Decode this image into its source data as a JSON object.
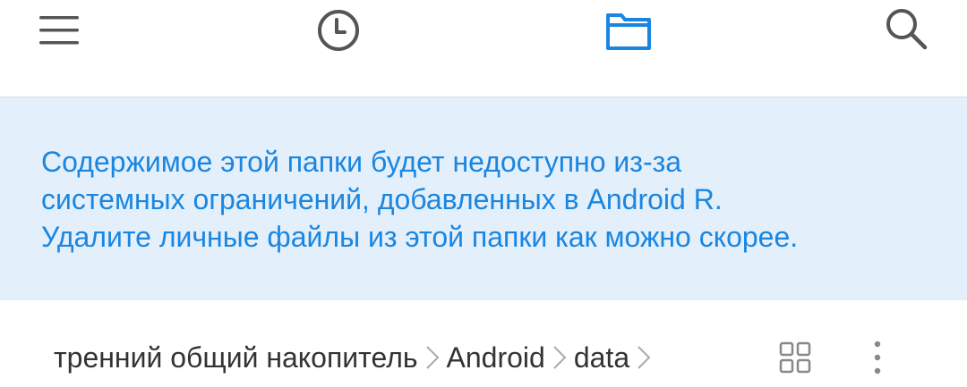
{
  "toolbar": {
    "icons": [
      "menu-icon",
      "clock-icon",
      "folder-icon",
      "search-icon"
    ],
    "accent": "#1a86e0",
    "icon_color": "#555555"
  },
  "notice": {
    "lines": [
      "Содержимое этой папки будет недоступно из-за",
      "системных ограничений, добавленных в Android R.",
      "Удалите личные файлы из этой папки как можно скорее."
    ],
    "background": "#e3effb",
    "text_color": "#1a86e0"
  },
  "breadcrumb": {
    "items": [
      "тренний общий накопитель",
      "Android",
      "data"
    ],
    "separator_icon": "chevron-right-icon"
  },
  "pathbar_icons": [
    "grid-view-icon",
    "more-vert-icon"
  ]
}
